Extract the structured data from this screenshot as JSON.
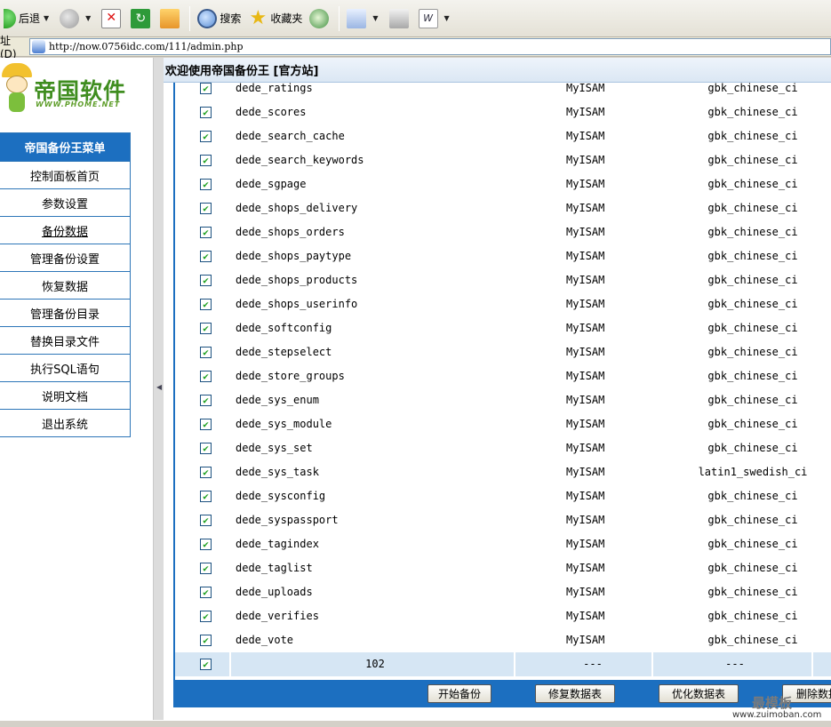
{
  "toolbar": {
    "back_label": "后退",
    "search_label": "搜索",
    "favorites_label": "收藏夹"
  },
  "address": {
    "label": "址 (D)",
    "url": "http://now.0756idc.com/111/admin.php"
  },
  "logo": {
    "text": "帝国软件",
    "url": "WWW.PHOME.NET"
  },
  "menu": {
    "title": "帝国备份王菜单",
    "items": [
      "控制面板首页",
      "参数设置",
      "备份数据",
      "管理备份设置",
      "恢复数据",
      "管理备份目录",
      "替换目录文件",
      "执行SQL语句",
      "说明文档",
      "退出系统"
    ]
  },
  "main": {
    "header": "欢迎使用帝国备份王 [官方站]"
  },
  "tables": [
    {
      "name": "dede_ratings",
      "engine": "MyISAM",
      "collation": "gbk_chinese_ci",
      "checked": "✔"
    },
    {
      "name": "dede_scores",
      "engine": "MyISAM",
      "collation": "gbk_chinese_ci",
      "checked": "✔"
    },
    {
      "name": "dede_search_cache",
      "engine": "MyISAM",
      "collation": "gbk_chinese_ci",
      "checked": "✔"
    },
    {
      "name": "dede_search_keywords",
      "engine": "MyISAM",
      "collation": "gbk_chinese_ci",
      "checked": "✔"
    },
    {
      "name": "dede_sgpage",
      "engine": "MyISAM",
      "collation": "gbk_chinese_ci",
      "checked": "✔"
    },
    {
      "name": "dede_shops_delivery",
      "engine": "MyISAM",
      "collation": "gbk_chinese_ci",
      "checked": "✔"
    },
    {
      "name": "dede_shops_orders",
      "engine": "MyISAM",
      "collation": "gbk_chinese_ci",
      "checked": "✔"
    },
    {
      "name": "dede_shops_paytype",
      "engine": "MyISAM",
      "collation": "gbk_chinese_ci",
      "checked": "✔"
    },
    {
      "name": "dede_shops_products",
      "engine": "MyISAM",
      "collation": "gbk_chinese_ci",
      "checked": "✔"
    },
    {
      "name": "dede_shops_userinfo",
      "engine": "MyISAM",
      "collation": "gbk_chinese_ci",
      "checked": "✔"
    },
    {
      "name": "dede_softconfig",
      "engine": "MyISAM",
      "collation": "gbk_chinese_ci",
      "checked": "✔"
    },
    {
      "name": "dede_stepselect",
      "engine": "MyISAM",
      "collation": "gbk_chinese_ci",
      "checked": "✔"
    },
    {
      "name": "dede_store_groups",
      "engine": "MyISAM",
      "collation": "gbk_chinese_ci",
      "checked": "✔"
    },
    {
      "name": "dede_sys_enum",
      "engine": "MyISAM",
      "collation": "gbk_chinese_ci",
      "checked": "✔"
    },
    {
      "name": "dede_sys_module",
      "engine": "MyISAM",
      "collation": "gbk_chinese_ci",
      "checked": "✔"
    },
    {
      "name": "dede_sys_set",
      "engine": "MyISAM",
      "collation": "gbk_chinese_ci",
      "checked": "✔"
    },
    {
      "name": "dede_sys_task",
      "engine": "MyISAM",
      "collation": "latin1_swedish_ci",
      "checked": "✔"
    },
    {
      "name": "dede_sysconfig",
      "engine": "MyISAM",
      "collation": "gbk_chinese_ci",
      "checked": "✔"
    },
    {
      "name": "dede_syspassport",
      "engine": "MyISAM",
      "collation": "gbk_chinese_ci",
      "checked": "✔"
    },
    {
      "name": "dede_tagindex",
      "engine": "MyISAM",
      "collation": "gbk_chinese_ci",
      "checked": "✔"
    },
    {
      "name": "dede_taglist",
      "engine": "MyISAM",
      "collation": "gbk_chinese_ci",
      "checked": "✔"
    },
    {
      "name": "dede_uploads",
      "engine": "MyISAM",
      "collation": "gbk_chinese_ci",
      "checked": "✔"
    },
    {
      "name": "dede_verifies",
      "engine": "MyISAM",
      "collation": "gbk_chinese_ci",
      "checked": "✔"
    },
    {
      "name": "dede_vote",
      "engine": "MyISAM",
      "collation": "gbk_chinese_ci",
      "checked": "✔"
    }
  ],
  "totals": {
    "checked": "✔",
    "count": "102",
    "dash1": "---",
    "dash2": "---"
  },
  "actions": {
    "start_backup": "开始备份",
    "repair_tables": "修复数据表",
    "optimize_tables": "优化数据表",
    "delete_data": "删除数据"
  },
  "watermark": {
    "main": "最模板",
    "sub": "www.zuimoban.com"
  },
  "colors": {
    "accent": "#1c6fc0",
    "total_row_bg": "#d6e6f4",
    "check": "#21a121"
  }
}
